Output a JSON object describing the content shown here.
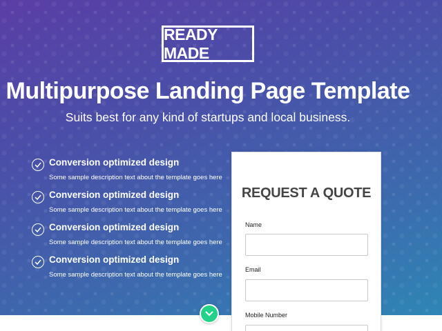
{
  "brand": {
    "logo_text": "READY MADE"
  },
  "hero": {
    "headline": "Multipurpose Landing Page Template",
    "subheadline": "Suits best for any kind of startups and local business."
  },
  "features": [
    {
      "title": "Conversion optimized design",
      "description": "Some sample description text about the template goes here",
      "icon": "check-circle-icon"
    },
    {
      "title": "Conversion optimized design",
      "description": "Some sample description text about the template goes here",
      "icon": "check-circle-icon"
    },
    {
      "title": "Conversion optimized design",
      "description": "Some sample description text about the template goes here",
      "icon": "check-circle-icon"
    },
    {
      "title": "Conversion optimized design",
      "description": "Some sample description text about the template goes here",
      "icon": "check-circle-icon"
    }
  ],
  "quote_form": {
    "title": "REQUEST A QUOTE",
    "fields": [
      {
        "label": "Name",
        "value": "",
        "placeholder": ""
      },
      {
        "label": "Email",
        "value": "",
        "placeholder": ""
      },
      {
        "label": "Mobile Number",
        "value": "",
        "placeholder": ""
      }
    ]
  },
  "scroll_button": {
    "icon": "chevron-down-icon"
  },
  "colors": {
    "gradient_start": "#5a3ea6",
    "gradient_end": "#2e86b6",
    "accent_green": "#23d18b",
    "quote_title": "#454545"
  }
}
